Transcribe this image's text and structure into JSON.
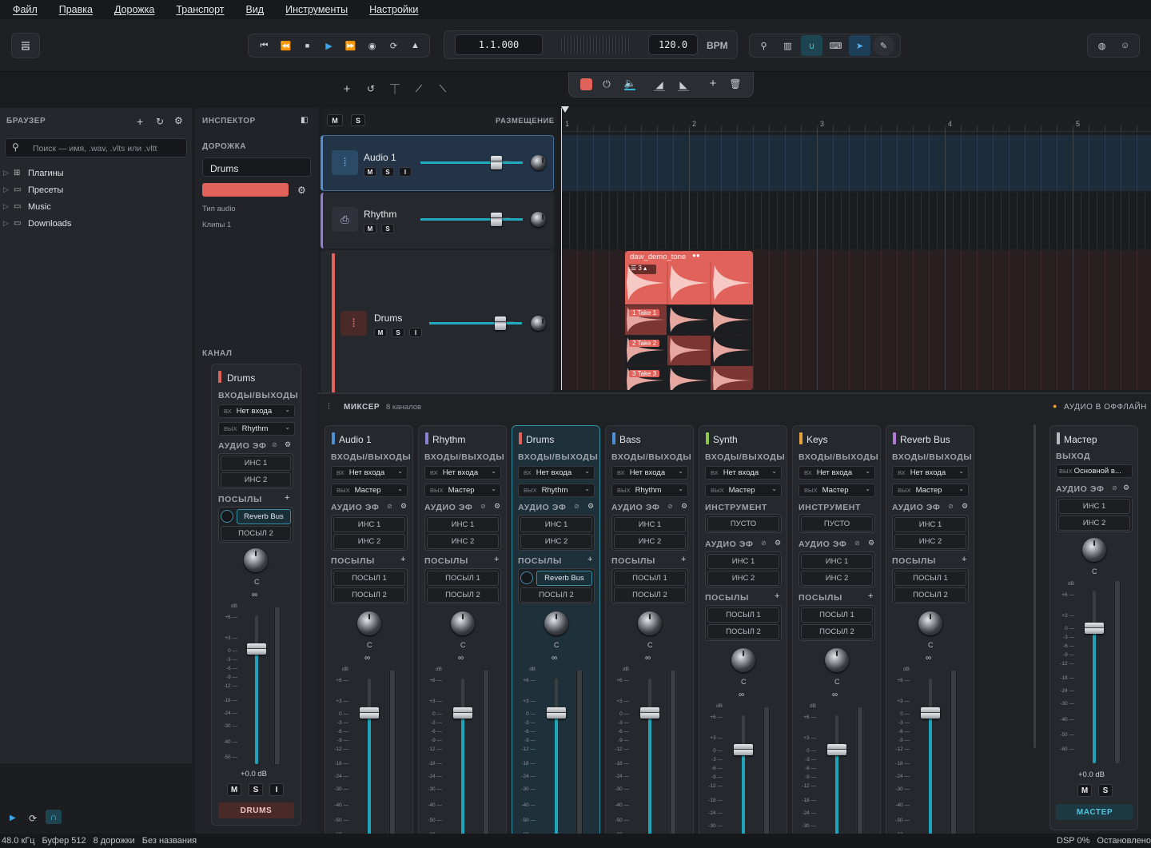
{
  "menu": [
    "Файл",
    "Правка",
    "Дорожка",
    "Транспорт",
    "Вид",
    "Инструменты",
    "Настройки"
  ],
  "transport": {
    "position": "1.1.000",
    "tempo": "120.0",
    "tempo_unit": "BPM"
  },
  "browser": {
    "title": "БРАУЗЕР",
    "search_placeholder": "Поиск — имя, .wav, .vlts или .vltt",
    "items": [
      "Плагины",
      "Пресеты",
      "Music",
      "Downloads"
    ]
  },
  "inspector": {
    "title": "ИНСПЕКТОР",
    "track_section": "ДОРОЖКА",
    "track_name": "Drums",
    "track_color": "#e0625a",
    "type_text": "Тип audio",
    "clips_text": "Клипы 1",
    "channel_section": "КАНАЛ",
    "channel": {
      "name": "Drums",
      "io_label": "ВХОДЫ/ВЫХОДЫ",
      "in_prefix": "ВХ",
      "in_value": "Нет входа",
      "out_prefix": "ВЫХ",
      "out_value": "Rhythm",
      "fx_label": "АУДИО ЭФ",
      "fx_slots": [
        "ИНС 1",
        "ИНС 2"
      ],
      "sends_label": "ПОСЫЛЫ",
      "sends": [
        "Reverb Bus",
        "ПОСЫЛ 2"
      ],
      "pan": "C",
      "db_unit": "dB",
      "gain": "+0.0 dB",
      "buttons": [
        "M",
        "S",
        "I"
      ],
      "footer": "DRUMS"
    }
  },
  "arrange": {
    "header_buttons": [
      "M",
      "S"
    ],
    "placement": "РАЗМЕЩЕНИЕ",
    "ruler": [
      "1",
      "2",
      "3",
      "4",
      "5"
    ],
    "tracks": [
      {
        "name": "Audio 1",
        "buttons": [
          "M",
          "S",
          "I"
        ],
        "color": "#4e8fd6"
      },
      {
        "name": "Rhythm",
        "buttons": [
          "M",
          "S"
        ],
        "color": "#8e7fd0"
      },
      {
        "name": "Drums",
        "buttons": [
          "M",
          "S",
          "I"
        ],
        "color": "#e0625a"
      }
    ],
    "clip": {
      "name": "daw_demo_tone",
      "take_count": "3",
      "takes": [
        "1  Take 1",
        "2  Take 2",
        "3  Take 3"
      ]
    }
  },
  "mixer": {
    "title": "МИКСЕР",
    "subtitle": "8 каналов",
    "offline": "АУДИО В ОФФЛАЙН",
    "io_label": "ВХОДЫ/ВЫХОДЫ",
    "fx_label": "АУДИО ЭФ",
    "instrument_label": "ИНСТРУМЕНТ",
    "instrument_empty": "ПУСТО",
    "sends_label": "ПОСЫЛЫ",
    "in_prefix": "ВХ",
    "out_prefix": "ВЫХ",
    "db_unit": "dB",
    "pan": "C",
    "strips": [
      {
        "name": "Audio 1",
        "color": "#4e8fd6",
        "input": "Нет входа",
        "output": "Мастер",
        "instrument": false,
        "fx": [
          "ИНС 1",
          "ИНС 2"
        ],
        "sends": [
          "ПОСЫЛ 1",
          "ПОСЫЛ 2"
        ]
      },
      {
        "name": "Rhythm",
        "color": "#8e7fd0",
        "input": "Нет входа",
        "output": "Мастер",
        "instrument": false,
        "fx": [
          "ИНС 1",
          "ИНС 2"
        ],
        "sends": [
          "ПОСЫЛ 1",
          "ПОСЫЛ 2"
        ]
      },
      {
        "name": "Drums",
        "color": "#e0625a",
        "input": "Нет входа",
        "output": "Rhythm",
        "instrument": false,
        "fx": [
          "ИНС 1",
          "ИНС 2"
        ],
        "sends": [
          "Reverb Bus",
          "ПОСЫЛ 2"
        ],
        "selected": true
      },
      {
        "name": "Bass",
        "color": "#4e8fd6",
        "input": "Нет входа",
        "output": "Rhythm",
        "instrument": false,
        "fx": [
          "ИНС 1",
          "ИНС 2"
        ],
        "sends": [
          "ПОСЫЛ 1",
          "ПОСЫЛ 2"
        ]
      },
      {
        "name": "Synth",
        "color": "#8cc84b",
        "input": "Нет входа",
        "output": "Мастер",
        "instrument": true,
        "fx": [
          "ИНС 1",
          "ИНС 2"
        ],
        "sends": [
          "ПОСЫЛ 1",
          "ПОСЫЛ 2"
        ]
      },
      {
        "name": "Keys",
        "color": "#e8a23c",
        "input": "Нет входа",
        "output": "Мастер",
        "instrument": true,
        "fx": [
          "ИНС 1",
          "ИНС 2"
        ],
        "sends": [
          "ПОСЫЛ 1",
          "ПОСЫЛ 2"
        ]
      },
      {
        "name": "Reverb Bus",
        "color": "#b27ad8",
        "input": "Нет входа",
        "output": "Мастер",
        "instrument": false,
        "fx": [
          "ИНС 1",
          "ИНС 2"
        ],
        "sends": [
          "ПОСЫЛ 1",
          "ПОСЫЛ 2"
        ]
      }
    ],
    "master": {
      "name": "Мастер",
      "out_label": "ВЫХОД",
      "out_prefix": "ВЫХ",
      "out_value": "Основной в...",
      "fx_label": "АУДИО ЭФ",
      "fx": [
        "ИНС 1",
        "ИНС 2"
      ],
      "pan": "C",
      "gain": "+0.0 dB",
      "buttons": [
        "M",
        "S"
      ],
      "footer": "МАСТЕР"
    }
  },
  "scale": [
    "dB",
    "+6",
    "+3",
    "0",
    "-3",
    "-6",
    "-9",
    "-12",
    "-18",
    "-24",
    "-30",
    "-40",
    "-50",
    "-60"
  ],
  "status": {
    "rate": "48.0 кГц",
    "buffer": "Буфер 512",
    "tracks": "8 дорожки",
    "project": "Без названия",
    "dsp": "DSP 0%",
    "state": "Остановлено"
  }
}
